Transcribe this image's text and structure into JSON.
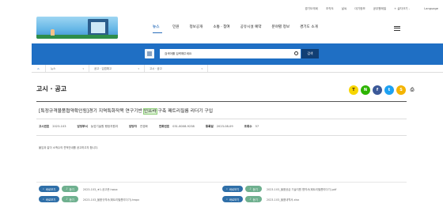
{
  "utility": {
    "items": [
      "경기도의회",
      "조직도",
      "날씨",
      "대기정보",
      "공무원메일"
    ],
    "font_size": "+ 글자크기 -",
    "language": "Language"
  },
  "nav": {
    "items": [
      "뉴스",
      "민원",
      "정보공개",
      "소통 · 참여",
      "공유시설 예약",
      "분야별 정보",
      "경기도 소개"
    ],
    "active_index": 0
  },
  "search": {
    "placeholder": "검색어를 입력해주세요",
    "button": "검색"
  },
  "breadcrumb": {
    "home": "뉴스",
    "level1": "공고 · 입법예고",
    "level2": "고시 · 공고"
  },
  "page": {
    "title": "고시 · 공고"
  },
  "share": {
    "icons": [
      "kakao-talk-icon",
      "naver-band-icon",
      "facebook-icon",
      "twitter-icon",
      "kakao-story-icon",
      "print-icon"
    ],
    "glyphs": [
      "T",
      "N",
      "f",
      "t",
      "S",
      "⎙"
    ],
    "colors": [
      "#f7d600",
      "#2db400",
      "#3b5998",
      "#1da1f2",
      "#f4b400",
      "#ffffff"
    ]
  },
  "post": {
    "title_before": "[특정규격물품협약확인됨]경기 지역특화작목 연구기반 ",
    "title_highlight": "인프라",
    "title_after": " 구축 패트리필름 리더기 구입",
    "meta": [
      {
        "key": "고시번호",
        "value": "2023-103"
      },
      {
        "key": "담당부서",
        "value": "농업기술원 행정지원과"
      },
      {
        "key": "담당자",
        "value": "연경화"
      },
      {
        "key": "전화번호",
        "value": "031-8008-9238"
      },
      {
        "key": "등록일",
        "value": "2023-08-09"
      },
      {
        "key": "조회수",
        "value": "57"
      }
    ],
    "body": "붙임과 같이 소액수의 견적안내를 공고하고자 합니다."
  },
  "attachments": {
    "view_label": "바로보기",
    "listen_label": "듣기",
    "files": [
      "2023-103_★1.공고문.hwpx",
      "2023-103_물품공급 기술지원 협약서(패트리필름리더기).pdf",
      "2023-103_물품규격서(패트리필름리더기).hwpx",
      "2023-103_물품내역서.xlsx"
    ]
  }
}
